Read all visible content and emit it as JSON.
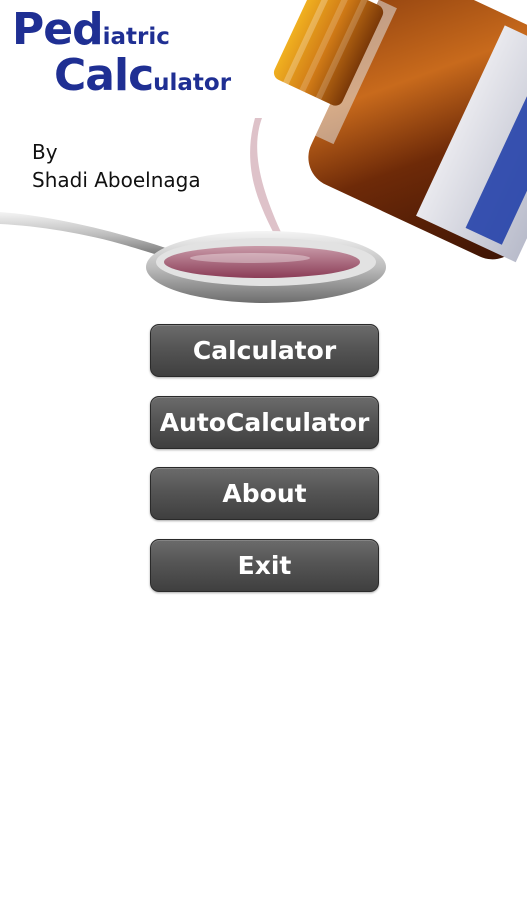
{
  "header": {
    "title": {
      "line1_big": "Ped",
      "line1_small": "iatric",
      "line2_big": "Calc",
      "line2_small": "ulator"
    },
    "author_prefix": "By",
    "author_name": "Shadi Aboelnaga"
  },
  "menu": {
    "items": [
      {
        "label": "Calculator"
      },
      {
        "label": "AutoCalculator"
      },
      {
        "label": "About"
      },
      {
        "label": "Exit"
      }
    ]
  },
  "colors": {
    "title": "#1f2f93",
    "button_face": "#555555",
    "button_text": "#ffffff",
    "background": "#ffffff"
  },
  "icons": {
    "header_art": "medicine-bottle-pouring-into-spoon"
  }
}
